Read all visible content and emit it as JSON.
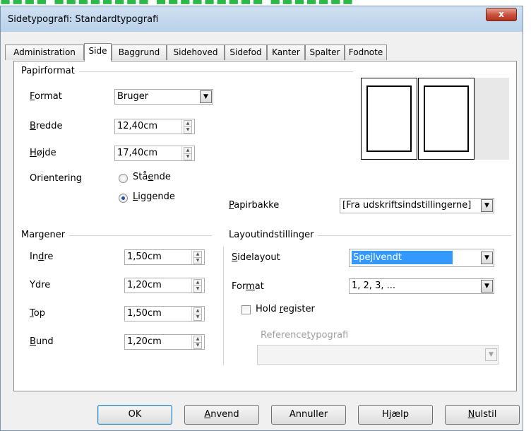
{
  "window": {
    "title": "Sidetypografi: Standardtypografi",
    "close_label": "x"
  },
  "tabs": [
    "Administration",
    "Side",
    "Baggrund",
    "Sidehoved",
    "Sidefod",
    "Kanter",
    "Spalter",
    "Fodnote"
  ],
  "active_tab": "Side",
  "paper": {
    "group": "Papirformat",
    "format": {
      "label_u": "F",
      "label_rest": "ormat",
      "value": "Bruger"
    },
    "width": {
      "label_u": "B",
      "label_rest": "redde",
      "value": "12,40cm"
    },
    "height": {
      "label_u": "H",
      "label_rest": "øjde",
      "value": "17,40cm"
    },
    "orientation": {
      "label": "Orientering",
      "portrait_pre": "Stå",
      "portrait_u": "e",
      "portrait_post": "nde",
      "landscape_u": "L",
      "landscape_rest": "iggende",
      "selected": "landscape"
    },
    "tray": {
      "label_u": "P",
      "label_rest": "apirbakke",
      "value": "[Fra udskriftsindstillingerne]"
    }
  },
  "margins": {
    "group": "Margener",
    "inner": {
      "label_pre": "In",
      "label_u": "d",
      "label_post": "re",
      "value": "1,50cm"
    },
    "outer": {
      "label": "Ydre",
      "value": "1,20cm"
    },
    "top": {
      "label_u": "T",
      "label_rest": "op",
      "value": "1,50cm"
    },
    "bottom": {
      "label_u": "B",
      "label_rest": "und",
      "value": "1,20cm"
    }
  },
  "layout": {
    "group": "Layoutindstillinger",
    "page_layout": {
      "label_u": "S",
      "label_rest": "idelayout",
      "value": "Spejlvendt",
      "highlight": "#3399ff"
    },
    "format": {
      "label_pre": "For",
      "label_u": "m",
      "label_post": "at",
      "value": "1, 2, 3, ..."
    },
    "hold_register": {
      "label_pre": "Hold ",
      "label_u": "r",
      "label_post": "egister",
      "checked": false
    },
    "ref_style": {
      "label_pre": "Reference",
      "label_u": "t",
      "label_post": "ypografi",
      "value": ""
    }
  },
  "buttons": {
    "ok": "OK",
    "apply_u": "A",
    "apply_rest": "nvend",
    "cancel": "Annuller",
    "help_pre": "H",
    "help_u": "j",
    "help_post": "ælp",
    "reset_u": "N",
    "reset_rest": "ulstil"
  }
}
